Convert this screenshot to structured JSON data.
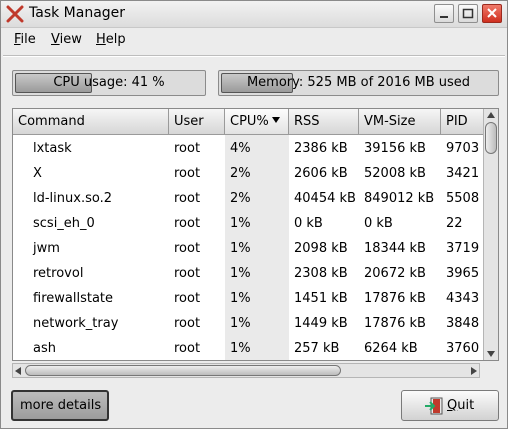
{
  "window": {
    "title": "Task Manager"
  },
  "menu": [
    {
      "first": "F",
      "rest": "ile"
    },
    {
      "first": "V",
      "rest": "iew"
    },
    {
      "first": "H",
      "rest": "elp"
    }
  ],
  "cpu": {
    "label": "CPU usage:  41 %",
    "usage_fraction": 0.41
  },
  "memory": {
    "label": "Memory:  525 MB of 2016 MB used",
    "usage_fraction": 0.26
  },
  "columns": [
    "Command",
    "User",
    "CPU%",
    "RSS",
    "VM-Size",
    "PID"
  ],
  "sorted_column": "CPU%",
  "processes": [
    {
      "command": "lxtask",
      "user": "root",
      "cpu": "4%",
      "rss": "2386 kB",
      "vmsize": "39156 kB",
      "pid": "9703"
    },
    {
      "command": "X",
      "user": "root",
      "cpu": "2%",
      "rss": "2606 kB",
      "vmsize": "52008 kB",
      "pid": "3421"
    },
    {
      "command": "ld-linux.so.2",
      "user": "root",
      "cpu": "2%",
      "rss": "40454 kB",
      "vmsize": "849012 kB",
      "pid": "5508"
    },
    {
      "command": "scsi_eh_0",
      "user": "root",
      "cpu": "1%",
      "rss": "0 kB",
      "vmsize": "0 kB",
      "pid": "22"
    },
    {
      "command": "jwm",
      "user": "root",
      "cpu": "1%",
      "rss": "2098 kB",
      "vmsize": "18344 kB",
      "pid": "3719"
    },
    {
      "command": "retrovol",
      "user": "root",
      "cpu": "1%",
      "rss": "2308 kB",
      "vmsize": "20672 kB",
      "pid": "3965"
    },
    {
      "command": "firewallstate",
      "user": "root",
      "cpu": "1%",
      "rss": "1451 kB",
      "vmsize": "17876 kB",
      "pid": "4343"
    },
    {
      "command": "network_tray",
      "user": "root",
      "cpu": "1%",
      "rss": "1449 kB",
      "vmsize": "17876 kB",
      "pid": "3848"
    },
    {
      "command": "ash",
      "user": "root",
      "cpu": "1%",
      "rss": "257 kB",
      "vmsize": "6264 kB",
      "pid": "3760"
    }
  ],
  "buttons": {
    "more_details": "more details",
    "quit_first": "Q",
    "quit_rest": "uit"
  },
  "colors": {
    "close_button": "#d83a28",
    "quit_icon": "#c0392b",
    "sorted_column_bg": "#eaeaea"
  }
}
